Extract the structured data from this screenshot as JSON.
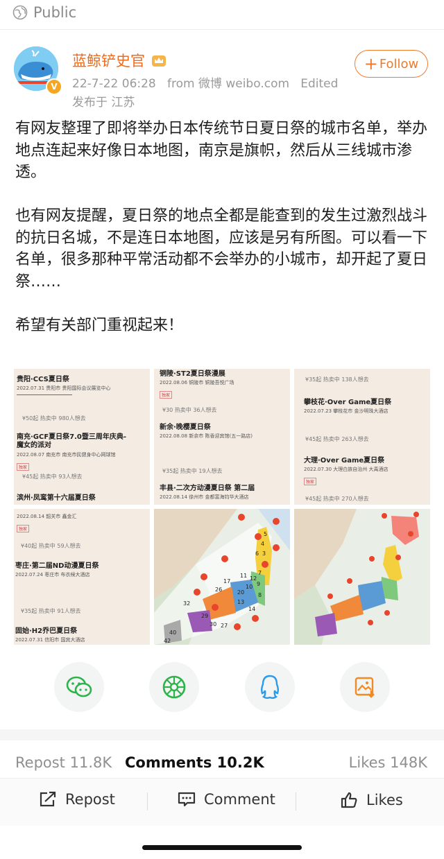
{
  "visibility": {
    "label": "Public",
    "icon": "globe-icon"
  },
  "author": {
    "name": "蓝鲸铲史官",
    "badge_icon": "crown-badge-icon",
    "verified_icon": "verified-v-icon",
    "date": "22-7-22 06:28",
    "source": "from 微博 weibo.com",
    "edited": "Edited",
    "location": "发布于 江苏",
    "name_color": "#f06a1a"
  },
  "follow_button": {
    "plus": "+",
    "label": "Follow",
    "color": "#f07a2a"
  },
  "post": {
    "text": "有网友整理了即将举办日本传统节日夏日祭的城市名单，举办地点连起来好像日本地图，南京是旗帜，然后从三线城市渗透。\n\n也有网友提醒，夏日祭的地点全都是能查到的发生过激烈战斗的抗日名城，不是连日本地图，应该是另有所图。可以看一下名单，很多那种平常活动都不会举办的小城市，却开起了夏日祭……\n\n希望有关部门重视起来！"
  },
  "images": {
    "img1": {
      "rows": [
        {
          "title": "贵阳·CCS夏日祭",
          "meta": "2022.07.31  贵阳市  贵阳国际会议展览中心",
          "stat": ""
        },
        {
          "title": "南充·GCF夏日祭7.0暨三周年庆典-魔女的派对",
          "meta": "2022.08.07  南充市  南充市民健身中心网球馆",
          "stat": "¥50起  热卖中  980人想去",
          "tag": "独家"
        },
        {
          "title": "滨州·凤鸾第十六届夏日祭",
          "meta": "",
          "stat": "¥45起  热卖中  93人想去"
        }
      ]
    },
    "img2": {
      "rows": [
        {
          "title": "铜陵·ST2夏日祭漫展",
          "meta": "2022.08.06  铜陵市  铜陵吾悦广场",
          "stat": "",
          "tag": "独家"
        },
        {
          "title": "新余·晚樱夏日祭",
          "meta": "2022.08.08  新余市  陈香迎宾馆(五一路店)",
          "stat": "¥30  热卖中  36人想去"
        },
        {
          "title": "丰县·二次方动漫夏日祭 第二届",
          "meta": "2022.08.14  徐州市  金都富海钧华大酒店",
          "stat": "¥35起  热卖中  19人想去"
        }
      ]
    },
    "img3": {
      "rows": [
        {
          "title": "攀枝花·Over Game夏日祭",
          "meta": "2022.07.23  攀枝花市  金沙明珠大酒店",
          "stat": "¥35起  热卖中  138人想去"
        },
        {
          "title": "大理·Over Game夏日祭",
          "meta": "2022.07.30  大理白族自治州  大禹酒店",
          "stat": "¥45起  热卖中  263人想去",
          "tag": "独家"
        },
        {
          "title": "",
          "meta": "",
          "stat": "¥45起  热卖中  270人想去"
        }
      ]
    },
    "img4": {
      "rows": [
        {
          "title": "",
          "meta": "2022.08.14  韶关市  鑫金汇",
          "stat": "",
          "tag": "独家"
        },
        {
          "title": "枣庄·第二届ND动漫夏日祭",
          "meta": "2022.07.24  枣庄市  布衣候大酒店",
          "stat": "¥40起  热卖中  59人想去"
        },
        {
          "title": "固始·H2乔巴夏日祭",
          "meta": "2022.07.31  信阳市  国宾大酒店",
          "stat": "¥35起  热卖中  91人想去"
        }
      ]
    },
    "map_labels": [
      "5",
      "4",
      "3",
      "6",
      "7",
      "9",
      "12",
      "11",
      "10",
      "8",
      "26",
      "20",
      "17",
      "32",
      "13",
      "14",
      "29",
      "27",
      "30",
      "40",
      "42"
    ],
    "colors": {
      "orange": "#f08a3a",
      "yellow": "#f4d03f",
      "green": "#7fc97f",
      "blue": "#5b9bd5",
      "purple": "#9b59b6",
      "red_dot": "#e8452c"
    }
  },
  "share": [
    {
      "icon": "wechat-icon",
      "color": "#2db34a"
    },
    {
      "icon": "moments-icon",
      "color": "#2db34a"
    },
    {
      "icon": "qq-icon",
      "color": "#2a9be8"
    },
    {
      "icon": "save-image-icon",
      "color": "#f08a22"
    }
  ],
  "stats": {
    "reposts": "Repost 11.8K",
    "comments": "Comments 10.2K",
    "likes": "Likes 148K"
  },
  "actions": {
    "repost": "Repost",
    "comment": "Comment",
    "likes": "Likes"
  }
}
